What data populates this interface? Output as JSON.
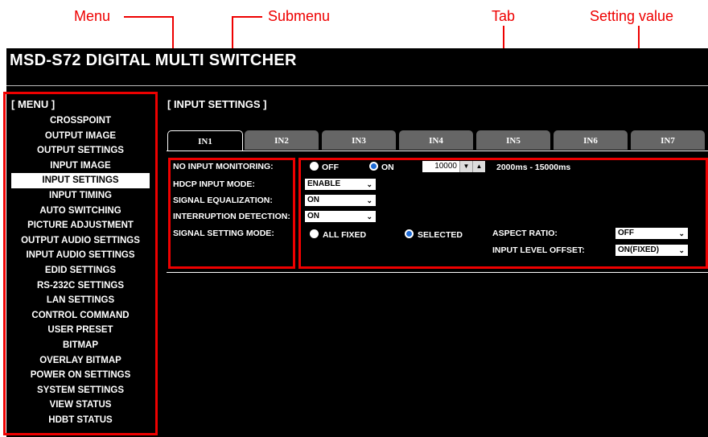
{
  "annotations": {
    "menu": "Menu",
    "submenu": "Submenu",
    "tab": "Tab",
    "setting_value": "Setting value"
  },
  "app": {
    "title": "MSD-S72 DIGITAL MULTI SWITCHER",
    "menu_header": "[ MENU ]",
    "submenu_header": "[ INPUT SETTINGS ]",
    "menu_items": [
      "CROSSPOINT",
      "OUTPUT IMAGE",
      "OUTPUT SETTINGS",
      "INPUT IMAGE",
      "INPUT SETTINGS",
      "INPUT TIMING",
      "AUTO SWITCHING",
      "PICTURE ADJUSTMENT",
      "OUTPUT AUDIO SETTINGS",
      "INPUT AUDIO SETTINGS",
      "EDID SETTINGS",
      "RS-232C SETTINGS",
      "LAN SETTINGS",
      "CONTROL COMMAND",
      "USER PRESET",
      "BITMAP",
      "OVERLAY BITMAP",
      "POWER ON SETTINGS",
      "SYSTEM SETTINGS",
      "VIEW STATUS",
      "HDBT STATUS"
    ],
    "active_menu": "INPUT SETTINGS",
    "tabs": [
      "IN1",
      "IN2",
      "IN3",
      "IN4",
      "IN5",
      "IN6",
      "IN7"
    ],
    "active_tab": "IN1"
  },
  "settings": {
    "no_input_monitoring": {
      "label": "NO INPUT MONITORING:",
      "off_label": "OFF",
      "on_label": "ON",
      "value": "ON",
      "time": "10000",
      "down": "▼",
      "up": "▲",
      "range": "2000ms - 15000ms"
    },
    "hdcp_input_mode": {
      "label": "HDCP INPUT MODE:",
      "value": "ENABLE"
    },
    "signal_equalization": {
      "label": "SIGNAL EQUALIZATION:",
      "value": "ON"
    },
    "interruption_detection": {
      "label": "INTERRUPTION DETECTION:",
      "value": "ON"
    },
    "signal_setting_mode": {
      "label": "SIGNAL SETTING MODE:",
      "all_fixed_label": "ALL FIXED",
      "selected_label": "SELECTED",
      "value": "SELECTED"
    },
    "aspect_ratio": {
      "label": "ASPECT RATIO:",
      "value": "OFF"
    },
    "input_level_offset": {
      "label": "INPUT LEVEL OFFSET:",
      "value": "ON(FIXED)"
    }
  },
  "colors": {
    "annotation": "#e00000",
    "background": "#000000",
    "tab_inactive": "#666666",
    "radio_selected": "#1e6bd6"
  }
}
